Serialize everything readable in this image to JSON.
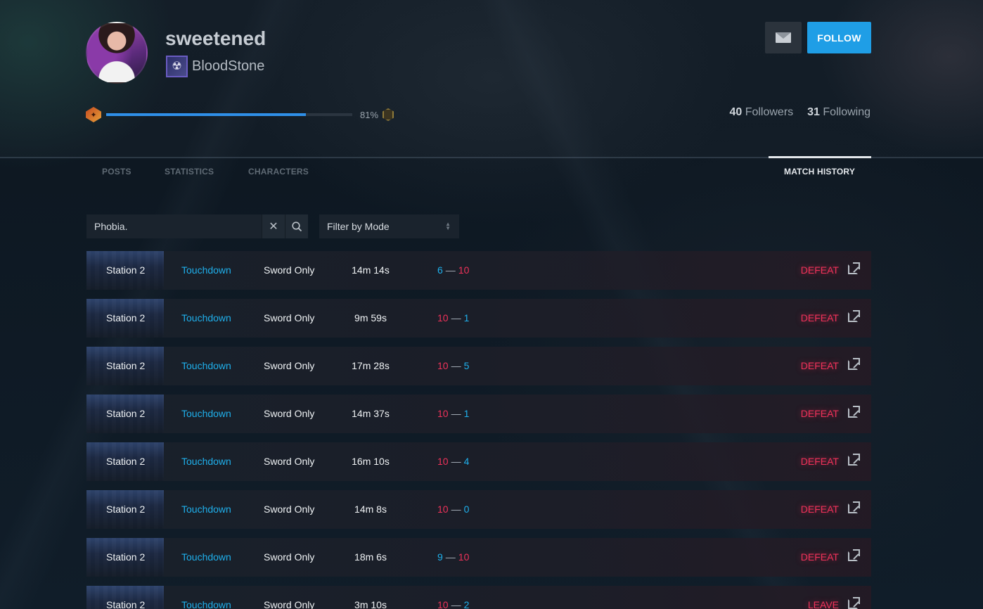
{
  "profile": {
    "username": "sweetened",
    "clan_name": "BloodStone",
    "xp_percent_label": "81%",
    "xp_progress": 0.81,
    "followers_count": "40",
    "followers_label": "Followers",
    "following_count": "31",
    "following_label": "Following"
  },
  "actions": {
    "message_icon": "mail-icon",
    "follow_label": "FOLLOW"
  },
  "tabs": [
    {
      "label": "POSTS",
      "active": false
    },
    {
      "label": "STATISTICS",
      "active": false
    },
    {
      "label": "CHARACTERS",
      "active": false
    },
    {
      "label": "MATCH HISTORY",
      "active": true
    }
  ],
  "search": {
    "value": "Phobia.",
    "clear_icon": "close-icon",
    "search_icon": "search-icon"
  },
  "filter": {
    "selected": "Filter by Mode"
  },
  "colors": {
    "accent_blue": "#1fb0ec",
    "defeat_red": "#f0325a",
    "follow_button": "#1f9ee6"
  },
  "matches": [
    {
      "map": "Station 2",
      "mode": "Touchdown",
      "variant": "Sword Only",
      "duration": "14m 14s",
      "score_left": "6",
      "score_right": "10",
      "left_color": "blue",
      "right_color": "red",
      "result": "DEFEAT"
    },
    {
      "map": "Station 2",
      "mode": "Touchdown",
      "variant": "Sword Only",
      "duration": "9m 59s",
      "score_left": "10",
      "score_right": "1",
      "left_color": "red",
      "right_color": "blue",
      "result": "DEFEAT"
    },
    {
      "map": "Station 2",
      "mode": "Touchdown",
      "variant": "Sword Only",
      "duration": "17m 28s",
      "score_left": "10",
      "score_right": "5",
      "left_color": "red",
      "right_color": "blue",
      "result": "DEFEAT"
    },
    {
      "map": "Station 2",
      "mode": "Touchdown",
      "variant": "Sword Only",
      "duration": "14m 37s",
      "score_left": "10",
      "score_right": "1",
      "left_color": "red",
      "right_color": "blue",
      "result": "DEFEAT"
    },
    {
      "map": "Station 2",
      "mode": "Touchdown",
      "variant": "Sword Only",
      "duration": "16m 10s",
      "score_left": "10",
      "score_right": "4",
      "left_color": "red",
      "right_color": "blue",
      "result": "DEFEAT"
    },
    {
      "map": "Station 2",
      "mode": "Touchdown",
      "variant": "Sword Only",
      "duration": "14m 8s",
      "score_left": "10",
      "score_right": "0",
      "left_color": "red",
      "right_color": "blue",
      "result": "DEFEAT"
    },
    {
      "map": "Station 2",
      "mode": "Touchdown",
      "variant": "Sword Only",
      "duration": "18m 6s",
      "score_left": "9",
      "score_right": "10",
      "left_color": "blue",
      "right_color": "red",
      "result": "DEFEAT"
    },
    {
      "map": "Station 2",
      "mode": "Touchdown",
      "variant": "Sword Only",
      "duration": "3m 10s",
      "score_left": "10",
      "score_right": "2",
      "left_color": "red",
      "right_color": "blue",
      "result": "LEAVE"
    }
  ]
}
